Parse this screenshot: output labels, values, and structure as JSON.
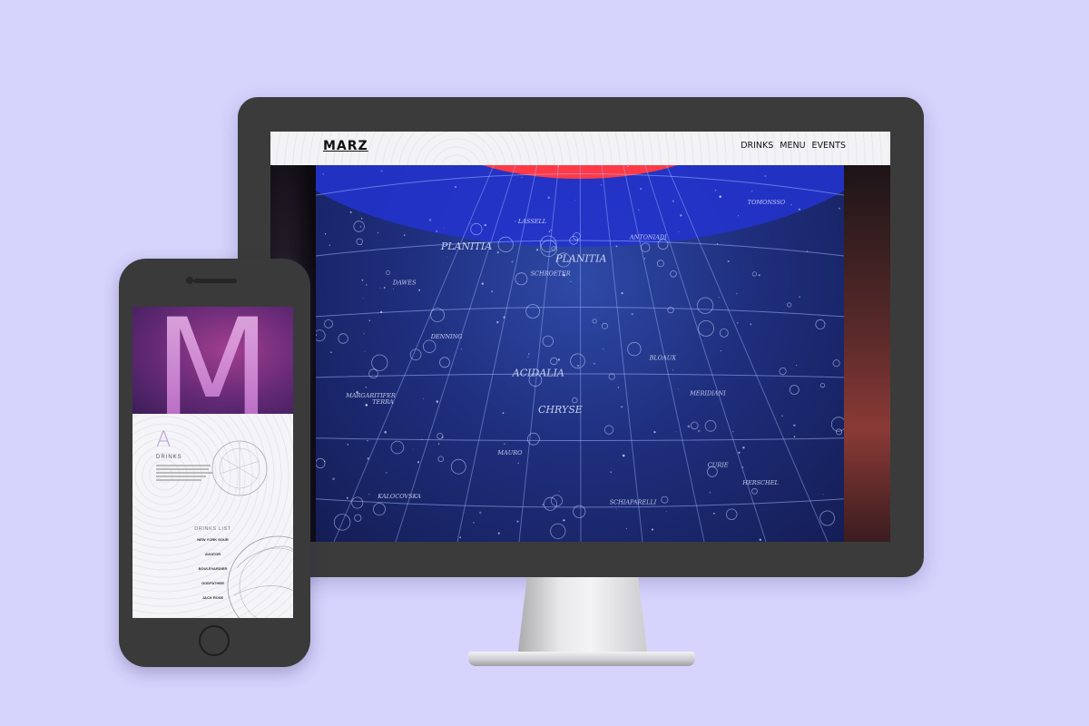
{
  "monitor": {
    "site": {
      "logo": "MARZ",
      "nav": [
        {
          "label": "DRINKS"
        },
        {
          "label": "MENU"
        },
        {
          "label": "EVENTS"
        }
      ]
    },
    "hero_map_labels": [
      "TOMONSSO",
      "ACIDALIA",
      "PLANITIA",
      "CHRYSE",
      "PLANITIA",
      "SCHIAPARELLI",
      "TERRA",
      "MERIDIANI",
      "MARGARITIFER",
      "DAWES",
      "ANTONIADI",
      "BLOAUX",
      "HERSCHEL",
      "LASSELL",
      "KALOCOVSKA",
      "CURIE",
      "MAURO",
      "SCHROETER",
      "DENNING"
    ]
  },
  "phone": {
    "hero_letter": "M",
    "section_letter": "A",
    "section_title": "DRINKS",
    "list_title": "DRINKS LIST",
    "list_items": [
      "NEW YORK SOUR",
      "AVIATOR",
      "BOULEVARDIER",
      "GODFATHER",
      "JACK ROSE"
    ]
  },
  "colors": {
    "background": "#d6d4fd",
    "device_body": "#3b3b3b",
    "hero_blue": "#1f2f7e",
    "hero_red": "#ff3a46",
    "phone_magenta": "#a13f8f"
  }
}
